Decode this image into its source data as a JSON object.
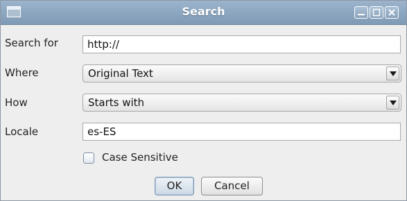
{
  "window": {
    "title": "Search"
  },
  "form": {
    "search_for": {
      "label": "Search for",
      "value": "http://"
    },
    "where": {
      "label": "Where",
      "selected": "Original Text"
    },
    "how": {
      "label": "How",
      "selected": "Starts with"
    },
    "locale": {
      "label": "Locale",
      "value": "es-ES"
    },
    "case_sensitive": {
      "label": "Case Sensitive",
      "checked": false
    }
  },
  "buttons": {
    "ok": "OK",
    "cancel": "Cancel"
  },
  "colors": {
    "titlebar": "#8aa3bb",
    "window_bg": "#eeeeee",
    "field_bg": "#ffffff"
  },
  "icons": {
    "window": "window-icon",
    "minimize": "minimize-icon",
    "maximize": "maximize-icon",
    "close": "close-icon",
    "dropdown": "chevron-down-icon"
  }
}
